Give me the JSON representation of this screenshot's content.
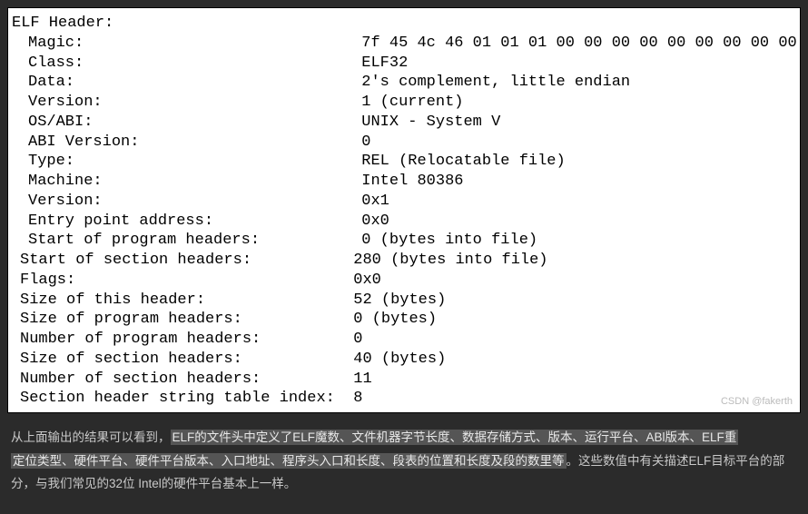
{
  "header": {
    "title": "ELF Header:",
    "rows": [
      {
        "label": "Magic:   ",
        "value": "7f 45 4c 46 01 01 01 00 00 00 00 00 00 00 00 00",
        "indent": 1
      },
      {
        "label": "Class:",
        "value": "ELF32",
        "indent": 1
      },
      {
        "label": "Data:",
        "value": "2's complement, little endian",
        "indent": 1
      },
      {
        "label": "Version:",
        "value": "1 (current)",
        "indent": 1
      },
      {
        "label": "OS/ABI:",
        "value": "UNIX - System V",
        "indent": 1
      },
      {
        "label": "ABI Version:",
        "value": "0",
        "indent": 1
      },
      {
        "label": "Type:",
        "value": "REL (Relocatable file)",
        "indent": 1
      },
      {
        "label": "Machine:",
        "value": "Intel 80386",
        "indent": 1
      },
      {
        "label": "Version:",
        "value": "0x1",
        "indent": 1
      },
      {
        "label": "Entry point address:",
        "value": "0x0",
        "indent": 1
      },
      {
        "label": "Start of program headers:",
        "value": "0 (bytes into file)",
        "indent": 1
      },
      {
        "label": "Start of section headers:",
        "value": "280 (bytes into file)",
        "indent": 2
      },
      {
        "label": "Flags:",
        "value": "0x0",
        "indent": 2
      },
      {
        "label": "Size of this header:",
        "value": "52 (bytes)",
        "indent": 2
      },
      {
        "label": "Size of program headers:",
        "value": "0 (bytes)",
        "indent": 2
      },
      {
        "label": "Number of program headers:",
        "value": "0",
        "indent": 2
      },
      {
        "label": "Size of section headers:",
        "value": "40 (bytes)",
        "indent": 2
      },
      {
        "label": "Number of section headers:",
        "value": "11",
        "indent": 2
      },
      {
        "label": "Section header string table index:",
        "value": "8",
        "indent": 2
      }
    ],
    "watermark": "CSDN @fakerth"
  },
  "explain": {
    "pre1": "从上面输出的结果可以看到，",
    "hl1": "ELF的文件头中定义了ELF魔数、文件机器字节长度、数据存储方式、版本、运行平台、ABl版本、ELF重",
    "hl2": "定位类型、硬件平台、硬件平台版本、入口地址、程序头入口和长度、段表的位置和长度及段的数里等",
    "post2": "。这些数值中有关描述ELF目标平台的部分，与我们常见的32位 Intel的硬件平台基本上一样。"
  },
  "layout": {
    "label_col_width": 36
  }
}
